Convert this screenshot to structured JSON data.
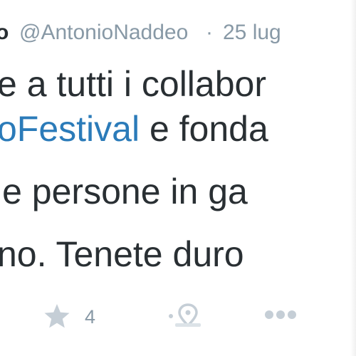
{
  "tweet": {
    "display_name_fragment": "o",
    "username": "@AntonioNaddeo",
    "separator": "·",
    "timestamp": "25 lug",
    "body": {
      "line1": "e a tutti i collabor",
      "line2_hashtag": "oFestival",
      "line2_rest": " e fonda",
      "line3": " le persone in ga",
      "line4": "no. Tenete duro"
    },
    "actions": {
      "favorite_count": "4",
      "favorite_icon": "star-icon",
      "place_icon": "location-pin-icon",
      "more_icon": "ellipsis-icon"
    },
    "colors": {
      "text": "#292f33",
      "muted": "#8899a6",
      "hashtag": "#2b7bb9",
      "icon": "#c5ced6"
    }
  }
}
